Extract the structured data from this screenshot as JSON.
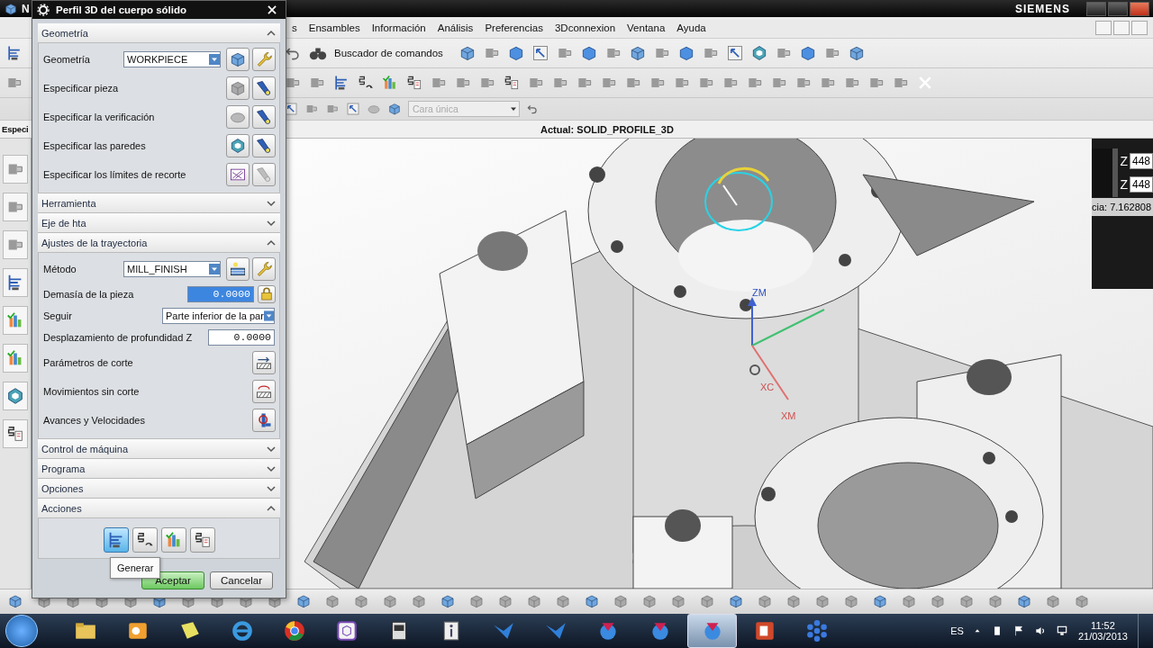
{
  "window": {
    "title": "N",
    "brand": "SIEMENS"
  },
  "menu": [
    {
      "label": "s"
    },
    {
      "label": "Ensambles"
    },
    {
      "label": "Información"
    },
    {
      "label": "Análisis"
    },
    {
      "label": "Preferencias"
    },
    {
      "label": "3Dconnexion"
    },
    {
      "label": "Ventana"
    },
    {
      "label": "Ayuda"
    }
  ],
  "toolbar": {
    "command_finder": "Buscador de comandos",
    "face_filter": {
      "value": "Cara única",
      "disabled": true
    }
  },
  "status_bar": {
    "resource_label": "Especi",
    "current": "Actual: SOLID_PROFILE_3D"
  },
  "viewport": {
    "axis_labels": [
      {
        "label": "ZM"
      },
      {
        "label": "XC"
      },
      {
        "label": "XM"
      }
    ],
    "coord_panel": {
      "fields": [
        {
          "label": "Z",
          "value": "448"
        },
        {
          "label": "Z",
          "value": "448"
        }
      ],
      "reading": "cia: 7.162808"
    }
  },
  "dialog": {
    "title": "Perfil 3D del cuerpo sólido",
    "sections": [
      {
        "title": "Geometría",
        "expanded": true,
        "rows": [
          {
            "kind": "select",
            "label": "Geometría",
            "value": "WORKPIECE"
          },
          {
            "kind": "pick",
            "label": "Especificar pieza",
            "specified": false,
            "display_enabled": true
          },
          {
            "kind": "pick",
            "label": "Especificar la verificación",
            "specified": false,
            "display_enabled": true
          },
          {
            "kind": "pick",
            "label": "Especificar las paredes",
            "specified": true,
            "display_enabled": true
          },
          {
            "kind": "pick",
            "label": "Especificar los límites de recorte",
            "specified": true,
            "display_enabled": false
          }
        ]
      },
      {
        "title": "Herramienta",
        "expanded": false
      },
      {
        "title": "Eje de hta",
        "expanded": false
      },
      {
        "title": "Ajustes de la trayectoria",
        "expanded": true,
        "rows": [
          {
            "kind": "select",
            "label": "Método",
            "value": "MILL_FINISH"
          },
          {
            "kind": "number",
            "label": "Demasía de la pieza",
            "value": "0.0000",
            "selected": true,
            "locked": true
          },
          {
            "kind": "dropdown",
            "label": "Seguir",
            "value": "Parte inferior de la par"
          },
          {
            "kind": "number",
            "label": "Desplazamiento de profundidad Z",
            "value": "0.0000",
            "selected": false,
            "locked": false
          },
          {
            "kind": "action",
            "label": "Parámetros de corte"
          },
          {
            "kind": "action",
            "label": "Movimientos sin corte"
          },
          {
            "kind": "action",
            "label": "Avances y Velocidades"
          }
        ]
      },
      {
        "title": "Control de máquina",
        "expanded": false
      },
      {
        "title": "Programa",
        "expanded": false
      },
      {
        "title": "Opciones",
        "expanded": false
      },
      {
        "title": "Acciones",
        "expanded": true,
        "actions": [
          {
            "selected": true
          },
          {
            "selected": false
          },
          {
            "selected": false
          },
          {
            "selected": false
          }
        ]
      }
    ],
    "tooltip": "Generar",
    "buttons": [
      {
        "label": "Aceptar",
        "default": true
      },
      {
        "label": "Cancelar",
        "default": false
      }
    ]
  },
  "taskbar": {
    "apps": [
      {
        "selected": false
      },
      {
        "selected": false
      },
      {
        "selected": false
      },
      {
        "selected": false
      },
      {
        "selected": false
      },
      {
        "selected": false
      },
      {
        "selected": false
      },
      {
        "selected": false
      },
      {
        "selected": false
      },
      {
        "selected": false
      },
      {
        "selected": false
      },
      {
        "selected": false
      },
      {
        "selected": true
      },
      {
        "selected": false
      },
      {
        "selected": false
      }
    ],
    "language": "ES",
    "time": "11:52",
    "date": "21/03/2013"
  }
}
